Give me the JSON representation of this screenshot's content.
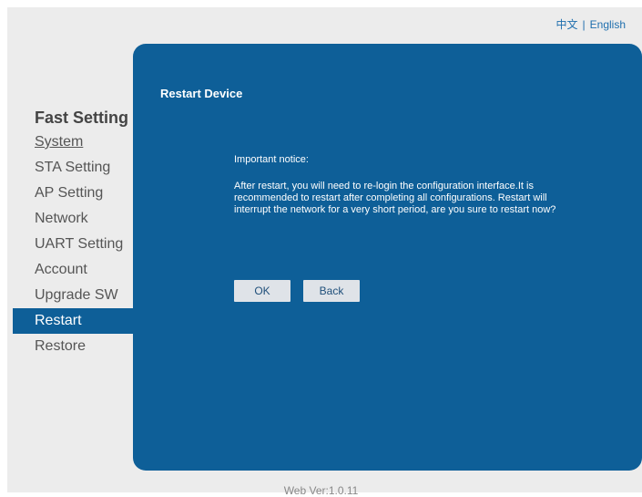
{
  "header": {
    "lang_chinese": "中文",
    "lang_separator": "|",
    "lang_english": "English"
  },
  "sidebar": {
    "title": "Fast Setting",
    "items": [
      {
        "label": "System"
      },
      {
        "label": "STA Setting"
      },
      {
        "label": "AP Setting"
      },
      {
        "label": "Network"
      },
      {
        "label": "UART Setting"
      },
      {
        "label": "Account"
      },
      {
        "label": "Upgrade SW"
      },
      {
        "label": "Restart"
      },
      {
        "label": "Restore"
      }
    ],
    "active_item": "Restart"
  },
  "panel": {
    "title": "Restart Device",
    "notice_heading": "Important notice:",
    "notice_body": "After restart, you will need to re-login the configuration interface.It is recommended to restart after completing all configurations. Restart will interrupt the network for a very short period, are you sure to restart now?",
    "ok_label": "OK",
    "back_label": "Back"
  },
  "footer": {
    "version": "Web Ver:1.0.11"
  },
  "colors": {
    "panel": "#0e5f98",
    "background": "#ececec",
    "button": "#dfe3e8"
  }
}
